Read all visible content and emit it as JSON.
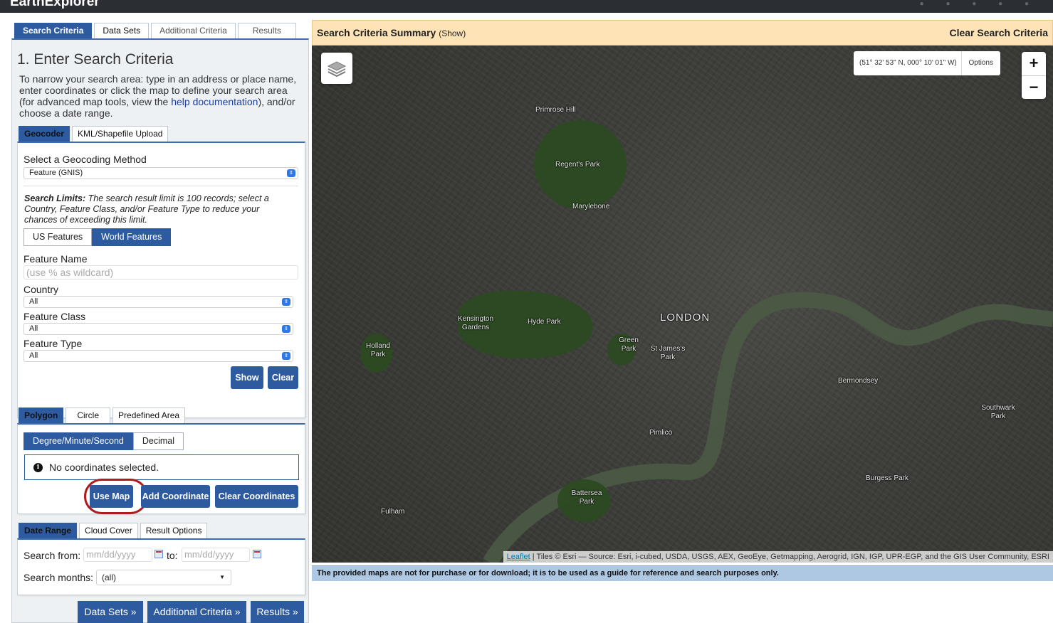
{
  "app": {
    "brand": "EarthExplorer"
  },
  "main_tabs": [
    {
      "label": "Search Criteria"
    },
    {
      "label": "Data Sets"
    },
    {
      "label": "Additional Criteria"
    },
    {
      "label": "Results"
    }
  ],
  "section_title": "1. Enter Search Criteria",
  "intro": {
    "before": "To narrow your search area: type in an address or place name, enter coordinates or click the map to define your search area (for advanced map tools, view the ",
    "link": "help documentation",
    "after": "), and/or choose a date range."
  },
  "geo_tabs": [
    {
      "label": "Geocoder"
    },
    {
      "label": "KML/Shapefile Upload"
    }
  ],
  "geocoder": {
    "method_label": "Select a Geocoding Method",
    "method_value": "Feature (GNIS)",
    "limits_bold": "Search Limits:",
    "limits_text": " The search result limit is 100 records; select a Country, Feature Class, and/or Feature Type to reduce your chances of exceeding this limit.",
    "us_features": "US Features",
    "world_features": "World Features",
    "feature_name_label": "Feature Name",
    "feature_name_placeholder": "(use % as wildcard)",
    "country_label": "Country",
    "country_value": "All",
    "feature_class_label": "Feature Class",
    "feature_class_value": "All",
    "feature_type_label": "Feature Type",
    "feature_type_value": "All",
    "show_btn": "Show",
    "clear_btn": "Clear"
  },
  "shape_tabs": [
    {
      "label": "Polygon"
    },
    {
      "label": "Circle"
    },
    {
      "label": "Predefined Area"
    }
  ],
  "polygon": {
    "dms": "Degree/Minute/Second",
    "decimal": "Decimal",
    "alert_icon": "info-icon",
    "alert_text": "No coordinates selected.",
    "use_map": "Use Map",
    "add_coordinate": "Add Coordinate",
    "clear_coordinates": "Clear Coordinates"
  },
  "date_tabs": [
    {
      "label": "Date Range"
    },
    {
      "label": "Cloud Cover"
    },
    {
      "label": "Result Options"
    }
  ],
  "date": {
    "from_label": "Search from:",
    "from_placeholder": "mm/dd/yyyy",
    "to_label": "to:",
    "to_placeholder": "mm/dd/yyyy",
    "months_label": "Search months:",
    "months_value": "(all)"
  },
  "nav_buttons": {
    "data_sets": "Data Sets »",
    "additional": "Additional Criteria »",
    "results": "Results »"
  },
  "summary": {
    "title": "Search Criteria Summary",
    "show": "(Show)",
    "clear": "Clear Search Criteria"
  },
  "map": {
    "coords": "(51° 32' 53\" N, 000° 10' 01\" W)",
    "options": "Options",
    "zoom_in": "+",
    "zoom_out": "−",
    "attribution_link": "Leaflet",
    "attribution_text": " | Tiles © Esri — Source: Esri, i-cubed, USDA, USGS, AEX, GeoEye, Getmapping, Aerogrid, IGN, IGP, UPR-EGP, and the GIS User Community, ESRI",
    "labels": {
      "primrose": "Primrose Hill",
      "regents": "Regent's Park",
      "marylebone": "Marylebone",
      "kensington": "Kensington Gardens",
      "hyde": "Hyde Park",
      "london": "LONDON",
      "holland": "Holland Park",
      "green": "Green Park",
      "stjames": "St James's Park",
      "bermondsey": "Bermondsey",
      "southwark": "Southwark Park",
      "pimlico": "Pimlico",
      "burgess": "Burgess Park",
      "battersea": "Battersea Park",
      "fulham": "Fulham"
    }
  },
  "disclaimer": "The provided maps are not for purchase or for download; it is to be used as a guide for reference and search purposes only.",
  "colors": {
    "accent": "#2e5ba0",
    "summary_bg": "#fde3b6",
    "disclaimer_bg": "#aec8e4",
    "highlight_ring": "#b01c1c"
  }
}
